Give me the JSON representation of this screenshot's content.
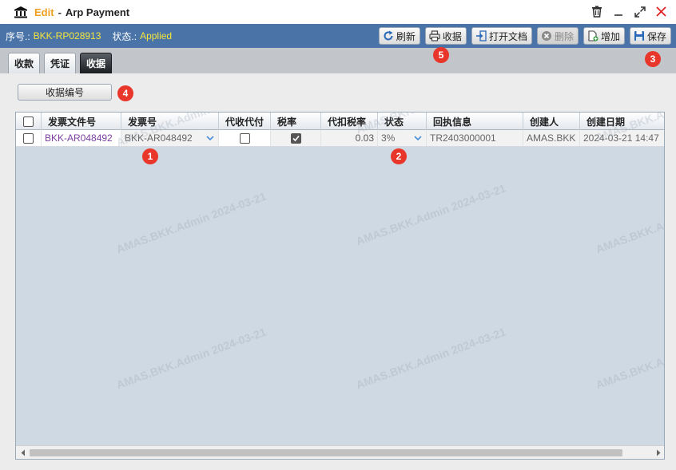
{
  "window": {
    "mode": "Edit",
    "separator": "-",
    "title": "Arp Payment"
  },
  "info": {
    "seq_label": "序号.:",
    "seq_value": "BKK-RP028913",
    "status_label": "状态.:",
    "status_value": "Applied"
  },
  "toolbar": {
    "refresh": "刷新",
    "receipt": "收据",
    "open_doc": "打开文档",
    "delete": "删除",
    "add": "增加",
    "save": "保存"
  },
  "tabs": [
    "收款",
    "凭证",
    "收据"
  ],
  "receipt_number_button": "收据编号",
  "grid": {
    "columns": [
      "发票文件号",
      "发票号",
      "代收代付",
      "税率",
      "代扣税率",
      "状态",
      "回执信息",
      "创建人",
      "创建日期"
    ],
    "rows": [
      {
        "invoice_file_no": "BKK-AR048492",
        "invoice_no": "BKK-AR048492",
        "collect_pay": false,
        "tax_rate": true,
        "withholding_rate": "0.03",
        "status": "3%",
        "receipt_info": "TR2403000001",
        "creator": "AMAS.BKK",
        "created_date": "2024-03-21 14:47"
      }
    ]
  },
  "watermark": {
    "line1": "AMAS.BKK.Admin 2024-03-21"
  },
  "markers": [
    "1",
    "2",
    "3",
    "4",
    "5"
  ],
  "colors": {
    "infobar_bg": "#4a74a8",
    "status_value": "#f5e53b",
    "edit_mode": "#f0a020",
    "marker": "#e8362b",
    "link": "#7b3fa0"
  }
}
